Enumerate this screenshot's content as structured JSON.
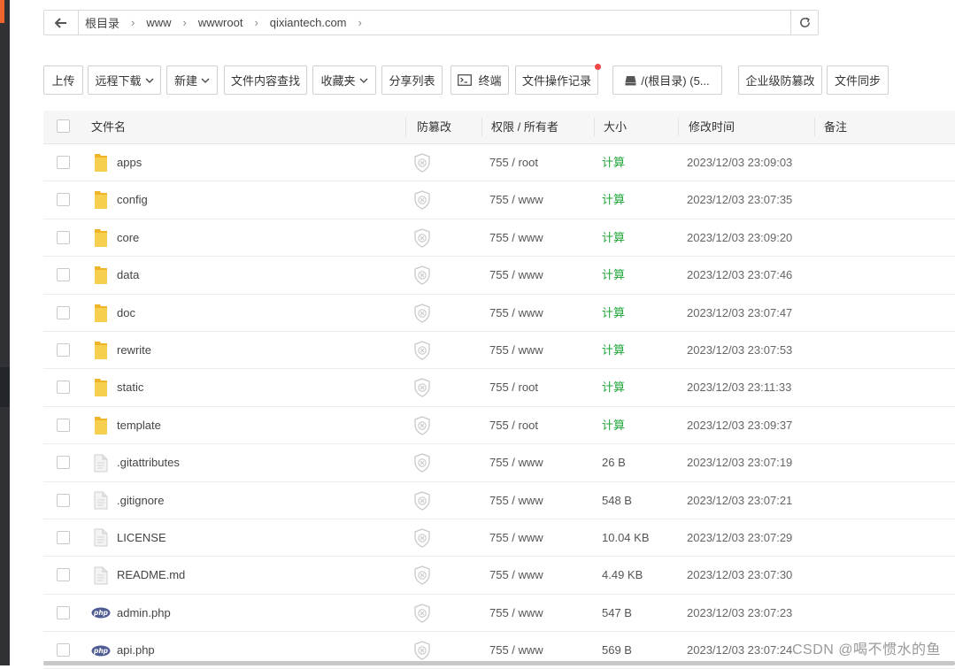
{
  "colors": {
    "accent_orange": "#f0642d",
    "calc_green": "#20a53a",
    "folder_yellow": "#f5c242",
    "php_blue": "#4f5b93",
    "red_dot": "#f04747"
  },
  "path": {
    "crumbs": [
      "根目录",
      "www",
      "wwwroot",
      "qixiantech.com"
    ],
    "back_icon": "arrow-left-icon",
    "refresh_icon": "refresh-icon"
  },
  "toolbar": {
    "upload": "上传",
    "remote_download": "远程下载",
    "new": "新建",
    "content_search": "文件内容查找",
    "favorites": "收藏夹",
    "share_list": "分享列表",
    "terminal": "终端",
    "op_log": "文件操作记录",
    "disk": "/(根目录) (5...",
    "tamper": "企业级防篡改",
    "sync": "文件同步"
  },
  "table": {
    "headers": {
      "name": "文件名",
      "tamper": "防篡改",
      "perm": "权限 / 所有者",
      "size": "大小",
      "mtime": "修改时间",
      "note": "备注"
    },
    "rows": [
      {
        "type": "folder",
        "name": "apps",
        "perm": "755 / root",
        "size": "计算",
        "mtime": "2023/12/03 23:09:03"
      },
      {
        "type": "folder",
        "name": "config",
        "perm": "755 / www",
        "size": "计算",
        "mtime": "2023/12/03 23:07:35"
      },
      {
        "type": "folder",
        "name": "core",
        "perm": "755 / www",
        "size": "计算",
        "mtime": "2023/12/03 23:09:20"
      },
      {
        "type": "folder",
        "name": "data",
        "perm": "755 / www",
        "size": "计算",
        "mtime": "2023/12/03 23:07:46"
      },
      {
        "type": "folder",
        "name": "doc",
        "perm": "755 / www",
        "size": "计算",
        "mtime": "2023/12/03 23:07:47"
      },
      {
        "type": "folder",
        "name": "rewrite",
        "perm": "755 / www",
        "size": "计算",
        "mtime": "2023/12/03 23:07:53"
      },
      {
        "type": "folder",
        "name": "static",
        "perm": "755 / root",
        "size": "计算",
        "mtime": "2023/12/03 23:11:33"
      },
      {
        "type": "folder",
        "name": "template",
        "perm": "755 / root",
        "size": "计算",
        "mtime": "2023/12/03 23:09:37"
      },
      {
        "type": "file",
        "name": ".gitattributes",
        "perm": "755 / www",
        "size": "26 B",
        "mtime": "2023/12/03 23:07:19"
      },
      {
        "type": "file",
        "name": ".gitignore",
        "perm": "755 / www",
        "size": "548 B",
        "mtime": "2023/12/03 23:07:21"
      },
      {
        "type": "file",
        "name": "LICENSE",
        "perm": "755 / www",
        "size": "10.04 KB",
        "mtime": "2023/12/03 23:07:29"
      },
      {
        "type": "file",
        "name": "README.md",
        "perm": "755 / www",
        "size": "4.49 KB",
        "mtime": "2023/12/03 23:07:30"
      },
      {
        "type": "php",
        "name": "admin.php",
        "perm": "755 / www",
        "size": "547 B",
        "mtime": "2023/12/03 23:07:23"
      },
      {
        "type": "php",
        "name": "api.php",
        "perm": "755 / www",
        "size": "569 B",
        "mtime": "2023/12/03 23:07:24"
      }
    ]
  },
  "php_label": "php",
  "watermark": "CSDN @喝不惯水的鱼"
}
